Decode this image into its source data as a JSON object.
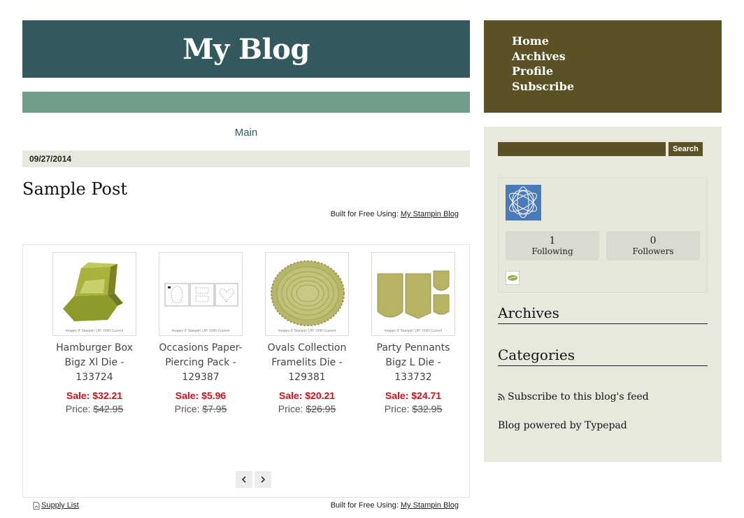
{
  "header": {
    "title": "My Blog"
  },
  "nav": {
    "items": [
      "Home",
      "Archives",
      "Profile",
      "Subscribe"
    ]
  },
  "main_nav": {
    "label": "Main"
  },
  "post": {
    "date": "09/27/2014",
    "title": "Sample Post",
    "built_prefix": "Built for Free Using:",
    "built_link": "My Stampin Blog"
  },
  "products": [
    {
      "name": "Hamburger Box Bigz Xl Die - 133724",
      "sale": "Sale: $32.21",
      "price_label": "Price:",
      "price": "$42.95",
      "image_icon": "hamburger-box-die-image"
    },
    {
      "name": "Occasions Paper-Piercing Pack - 129387",
      "sale": "Sale: $5.96",
      "price_label": "Price:",
      "price": "$7.95",
      "image_icon": "paper-piercing-pack-image"
    },
    {
      "name": "Ovals Collection Framelits Die - 129381",
      "sale": "Sale: $20.21",
      "price_label": "Price:",
      "price": "$26.95",
      "image_icon": "ovals-framelits-image"
    },
    {
      "name": "Party Pennants Bigz L Die - 133732",
      "sale": "Sale: $24.71",
      "price_label": "Price:",
      "price": "$32.95",
      "image_icon": "party-pennants-die-image"
    }
  ],
  "footer": {
    "supply_list": "Supply List"
  },
  "sidebar": {
    "search_button": "Search",
    "following_count": "1",
    "following_label": "Following",
    "followers_count": "0",
    "followers_label": "Followers",
    "archives_heading": "Archives",
    "categories_heading": "Categories",
    "subscribe_feed": "Subscribe to this blog's feed",
    "powered_by": "Blog powered by Typepad"
  },
  "colors": {
    "header_bg": "#33595f",
    "green_bar": "#6e9d8a",
    "nav_bg": "#5a5224",
    "sidebar_bg": "#e8e8dd",
    "sale_red": "#d0111a",
    "product_olive": "#b4b25e"
  }
}
